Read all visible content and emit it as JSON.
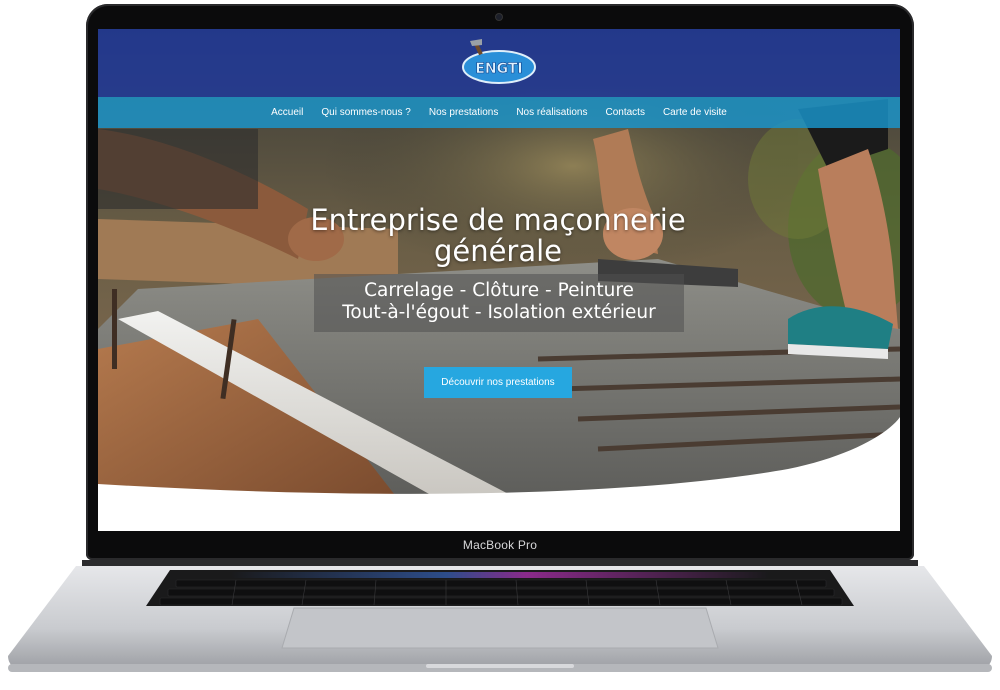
{
  "device": {
    "label": "MacBook Pro"
  },
  "site": {
    "logo_text": "ENGTI",
    "nav": [
      {
        "label": "Accueil"
      },
      {
        "label": "Qui sommes-nous ?"
      },
      {
        "label": "Nos prestations"
      },
      {
        "label": "Nos réalisations"
      },
      {
        "label": "Contacts"
      },
      {
        "label": "Carte de visite"
      }
    ],
    "hero": {
      "title_line1": "Entreprise de maçonnerie",
      "title_line2": "générale",
      "subtitle_line1": "Carrelage - Clôture - Peinture",
      "subtitle_line2": "Tout-à-l'égout - Isolation extérieur",
      "cta_label": "Découvrir nos prestations"
    }
  },
  "colors": {
    "header_blue": "#1e38a0",
    "nav_blue": "#1a96cd",
    "cta_blue": "#26a7e0"
  }
}
